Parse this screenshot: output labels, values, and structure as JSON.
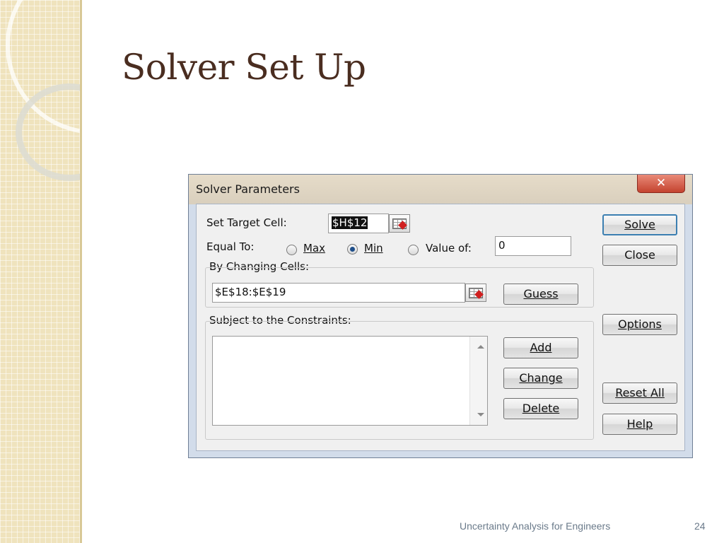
{
  "slide": {
    "title": "Solver Set Up",
    "footer": "Uncertainty Analysis for Engineers",
    "page_number": "24"
  },
  "dialog": {
    "title": "Solver Parameters",
    "close_glyph": "✕",
    "set_target_cell": {
      "label": "Set Target Cell:",
      "value": "$H$12"
    },
    "equal_to": {
      "label": "Equal To:",
      "options": [
        {
          "label": "Max",
          "selected": false
        },
        {
          "label": "Min",
          "selected": true
        },
        {
          "label": "Value of:",
          "selected": false
        }
      ],
      "value_of": "0"
    },
    "by_changing_cells": {
      "label": "By Changing Cells:",
      "value": "$E$18:$E$19"
    },
    "constraints": {
      "label": "Subject to the Constraints:",
      "items": []
    },
    "buttons": {
      "solve": "Solve",
      "close": "Close",
      "guess": "Guess",
      "options": "Options",
      "add": "Add",
      "change": "Change",
      "delete": "Delete",
      "reset_all": "Reset All",
      "help": "Help"
    }
  }
}
